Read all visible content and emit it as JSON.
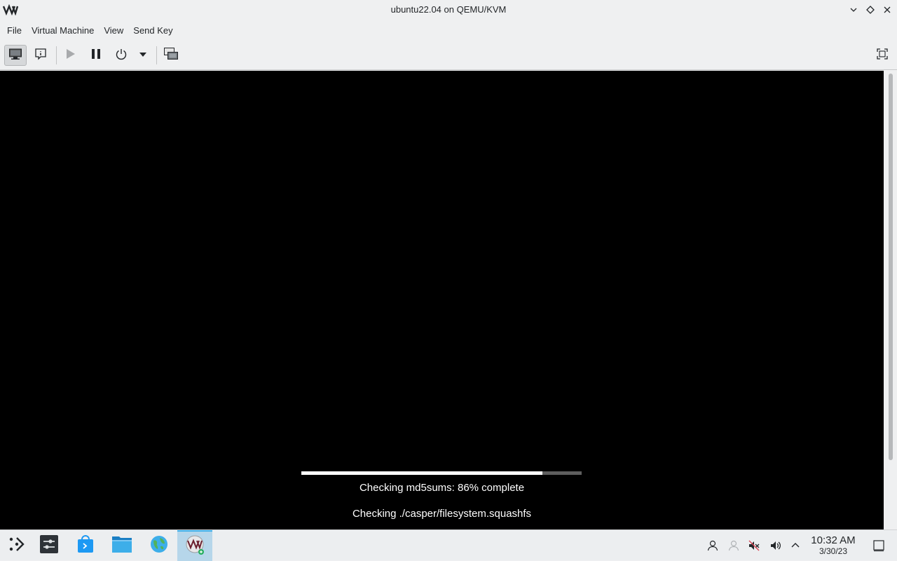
{
  "window": {
    "title": "ubuntu22.04 on QEMU/KVM",
    "logo_icon": "virt-manager-logo",
    "controls": [
      "minimize-icon",
      "maximize-icon",
      "close-icon"
    ]
  },
  "menubar": {
    "items": [
      "File",
      "Virtual Machine",
      "View",
      "Send Key"
    ]
  },
  "toolbar": {
    "buttons": [
      {
        "icon": "console-monitor-icon",
        "active": true
      },
      {
        "icon": "details-info-icon",
        "active": false
      },
      {
        "icon": "play-icon",
        "active": false,
        "disabled": true
      },
      {
        "icon": "pause-icon",
        "active": false
      },
      {
        "icon": "power-icon",
        "active": false
      },
      {
        "icon": "dropdown-arrow-icon",
        "active": false
      },
      {
        "icon": "snapshots-icon",
        "active": false
      },
      {
        "icon": "fullscreen-icon",
        "active": false
      }
    ]
  },
  "vm": {
    "progress_fraction": 0.86,
    "status_line": "Checking md5sums: 86% complete",
    "file_line": "Checking ./casper/filesystem.squashfs"
  },
  "taskbar": {
    "items": [
      {
        "icon": "app-launcher-icon"
      },
      {
        "icon": "system-settings-icon"
      },
      {
        "icon": "discover-store-icon"
      },
      {
        "icon": "file-manager-icon"
      },
      {
        "icon": "web-browser-icon"
      },
      {
        "icon": "virt-manager-icon",
        "active": true
      }
    ],
    "tray": [
      "user-icon",
      "network-icon",
      "muted-audio-icon",
      "volume-icon",
      "tray-expand-icon"
    ],
    "clock": {
      "time": "10:32 AM",
      "date": "3/30/23"
    },
    "show_desktop_icon": "show-desktop-icon"
  },
  "colors": {
    "accent": "#3daee9",
    "vm_background": "#000000",
    "progress_fill": "#ffffff",
    "progress_track": "#5e5e5e"
  }
}
